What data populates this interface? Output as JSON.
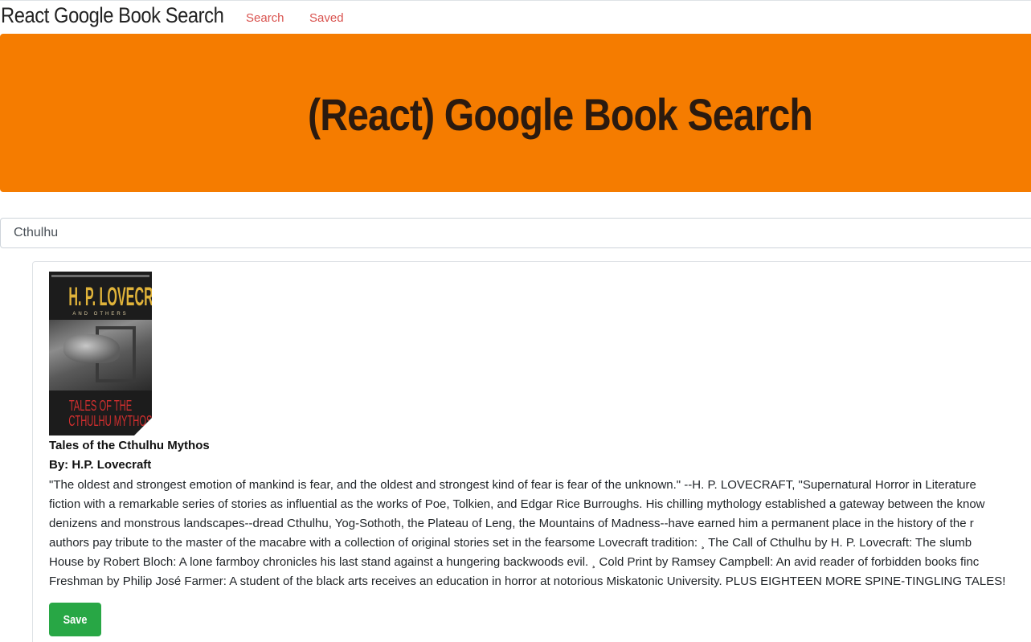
{
  "navbar": {
    "brand": "React Google Book Search",
    "links": [
      "Search",
      "Saved"
    ]
  },
  "jumbotron": {
    "title": "(React) Google Book Search"
  },
  "search": {
    "value": "Cthulhu"
  },
  "colors": {
    "jumbotron": "#f57c00",
    "nav_link": "#d9534f",
    "save_button": "#28a745"
  },
  "book": {
    "cover": {
      "author_text": "H. P. LOVECRAFT",
      "others_text": "AND OTHERS",
      "subtitle_line1": "TALES OF THE",
      "subtitle_line2": "CTHULHU MYTHOS"
    },
    "title": "Tales of the Cthulhu Mythos",
    "author_prefix": "By: ",
    "author": "H.P. Lovecraft",
    "description_lines": [
      "\"The oldest and strongest emotion of mankind is fear, and the oldest and strongest kind of fear is fear of the unknown.\" --H. P. LOVECRAFT, \"Supernatural Horror in Literature",
      "fiction with a remarkable series of stories as influential as the works of Poe, Tolkien, and Edgar Rice Burroughs. His chilling mythology established a gateway between the know",
      "denizens and monstrous landscapes--dread Cthulhu, Yog-Sothoth, the Plateau of Leng, the Mountains of Madness--have earned him a permanent place in the history of the r",
      "authors pay tribute to the master of the macabre with a collection of original stories set in the fearsome Lovecraft tradition: ¸ The Call of Cthulhu by H. P. Lovecraft: The slumb",
      "House by Robert Bloch: A lone farmboy chronicles his last stand against a hungering backwoods evil. ¸ Cold Print by Ramsey Campbell: An avid reader of forbidden books finc",
      "Freshman by Philip José Farmer: A student of the black arts receives an education in horror at notorious Miskatonic University. PLUS EIGHTEEN MORE SPINE-TINGLING TALES!"
    ],
    "save_label": "Save"
  }
}
